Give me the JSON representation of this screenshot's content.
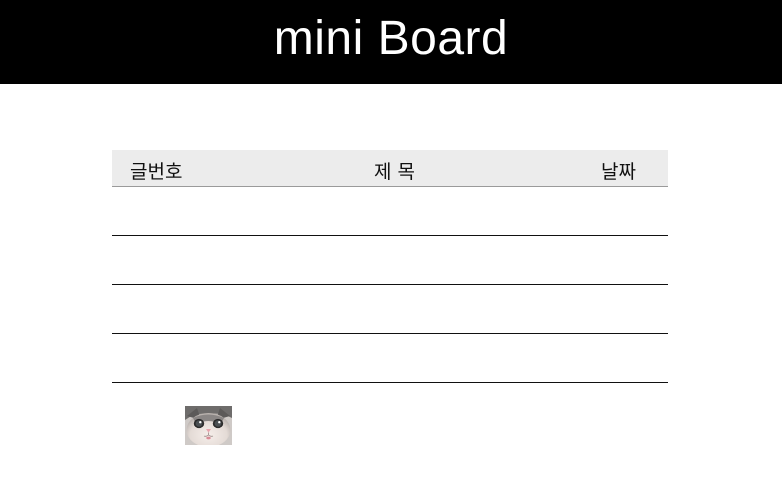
{
  "header": {
    "title": "mini Board"
  },
  "board": {
    "columns": {
      "number": "글번호",
      "title": "제 목",
      "date": "날짜"
    },
    "rows": [
      {
        "number": "",
        "title": "",
        "date": ""
      },
      {
        "number": "",
        "title": "",
        "date": ""
      },
      {
        "number": "",
        "title": "",
        "date": ""
      },
      {
        "number": "",
        "title": "",
        "date": ""
      }
    ]
  },
  "image": {
    "icon": "cat-face-thumbnail"
  },
  "colors": {
    "header_bg": "#000000",
    "header_text": "#ffffff",
    "table_header_bg": "#ececec",
    "row_divider": "#111111"
  }
}
